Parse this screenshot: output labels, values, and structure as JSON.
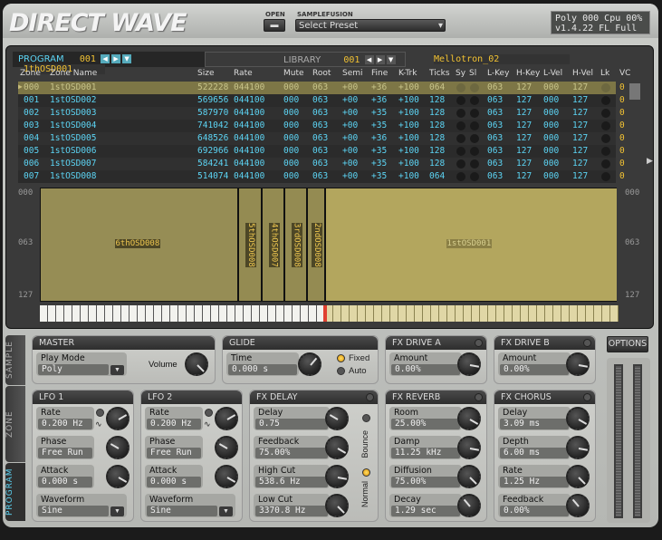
{
  "header": {
    "logo": "DIRECT WAVE",
    "open_label": "OPEN",
    "samplefusion_label": "SAMPLEFUSION",
    "preset_select": "Select Preset",
    "status_line1": "Poly 000 Cpu 00%",
    "status_line2": "v1.4.22  FL Full"
  },
  "program": {
    "tab": "PROGRAM",
    "number": "001",
    "name": "1thOSD001"
  },
  "library": {
    "tab": "LIBRARY",
    "number": "001",
    "name": "Mellotron_02"
  },
  "columns": [
    "Zone",
    "Zone Name",
    "Size",
    "Rate",
    "Mute",
    "Root",
    "Semi",
    "Fine",
    "K-Trk",
    "Ticks",
    "Sy",
    "Sl",
    "L-Key",
    "H-Key",
    "L-Vel",
    "H-Vel",
    "Lk",
    "VC"
  ],
  "rows": [
    [
      "000",
      "1stOSD001",
      "522228",
      "044100",
      "000",
      "063",
      "+00",
      "+36",
      "+100",
      "064",
      "",
      "",
      "063",
      "127",
      "000",
      "127",
      "",
      "0"
    ],
    [
      "001",
      "1stOSD002",
      "569656",
      "044100",
      "000",
      "063",
      "+00",
      "+36",
      "+100",
      "128",
      "",
      "",
      "063",
      "127",
      "000",
      "127",
      "",
      "0"
    ],
    [
      "002",
      "1stOSD003",
      "587970",
      "044100",
      "000",
      "063",
      "+00",
      "+35",
      "+100",
      "128",
      "",
      "",
      "063",
      "127",
      "000",
      "127",
      "",
      "0"
    ],
    [
      "003",
      "1stOSD004",
      "741042",
      "044100",
      "000",
      "063",
      "+00",
      "+35",
      "+100",
      "128",
      "",
      "",
      "063",
      "127",
      "000",
      "127",
      "",
      "0"
    ],
    [
      "004",
      "1stOSD005",
      "648526",
      "044100",
      "000",
      "063",
      "+00",
      "+36",
      "+100",
      "128",
      "",
      "",
      "063",
      "127",
      "000",
      "127",
      "",
      "0"
    ],
    [
      "005",
      "1stOSD006",
      "692966",
      "044100",
      "000",
      "063",
      "+00",
      "+35",
      "+100",
      "128",
      "",
      "",
      "063",
      "127",
      "000",
      "127",
      "",
      "0"
    ],
    [
      "006",
      "1stOSD007",
      "584241",
      "044100",
      "000",
      "063",
      "+00",
      "+35",
      "+100",
      "128",
      "",
      "",
      "063",
      "127",
      "000",
      "127",
      "",
      "0"
    ],
    [
      "007",
      "1stOSD008",
      "514074",
      "044100",
      "000",
      "063",
      "+00",
      "+35",
      "+100",
      "064",
      "",
      "",
      "063",
      "127",
      "000",
      "127",
      "",
      "0"
    ]
  ],
  "selected_row": 0,
  "zone_map": {
    "axis_left": [
      "000",
      "063",
      "127"
    ],
    "axis_right": [
      "000",
      "063",
      "127"
    ],
    "zones": [
      "6thOSD008",
      "5thOSD008",
      "4thOSD007",
      "3rdOSD008",
      "2ndOSD008",
      "1stOSD001"
    ]
  },
  "side_tabs": [
    "SAMPLE",
    "ZONE",
    "PROGRAM"
  ],
  "active_side_tab": "PROGRAM",
  "master": {
    "title": "MASTER",
    "play_mode_label": "Play Mode",
    "play_mode": "Poly",
    "volume_label": "Volume"
  },
  "glide": {
    "title": "GLIDE",
    "time_label": "Time",
    "time": "0.000 s",
    "fixed": "Fixed",
    "auto": "Auto",
    "selected": "Fixed"
  },
  "panels": {
    "drive_a": {
      "title": "FX DRIVE A",
      "params": [
        [
          "Amount",
          "0.00%"
        ]
      ]
    },
    "drive_b": {
      "title": "FX DRIVE B",
      "params": [
        [
          "Amount",
          "0.00%"
        ]
      ]
    },
    "lfo1": {
      "title": "LFO 1",
      "params": [
        [
          "Rate",
          "0.200 Hz"
        ],
        [
          "Phase",
          "Free Run"
        ],
        [
          "Attack",
          "0.000 s"
        ]
      ],
      "waveform_label": "Waveform",
      "waveform": "Sine"
    },
    "lfo2": {
      "title": "LFO 2",
      "params": [
        [
          "Rate",
          "0.200 Hz"
        ],
        [
          "Phase",
          "Free Run"
        ],
        [
          "Attack",
          "0.000 s"
        ]
      ],
      "waveform_label": "Waveform",
      "waveform": "Sine"
    },
    "delay": {
      "title": "FX DELAY",
      "params": [
        [
          "Delay",
          "0.75"
        ],
        [
          "Feedback",
          "75.00%"
        ],
        [
          "High Cut",
          "538.6 Hz"
        ],
        [
          "Low Cut",
          "3370.8 Hz"
        ]
      ],
      "bounce": "Bounce",
      "normal": "Normal",
      "mode": "Normal"
    },
    "reverb": {
      "title": "FX REVERB",
      "params": [
        [
          "Room",
          "25.00%"
        ],
        [
          "Damp",
          "11.25 kHz"
        ],
        [
          "Diffusion",
          "75.00%"
        ],
        [
          "Decay",
          "1.29 sec"
        ]
      ]
    },
    "chorus": {
      "title": "FX CHORUS",
      "params": [
        [
          "Delay",
          "3.09 ms"
        ],
        [
          "Depth",
          "6.00 ms"
        ],
        [
          "Rate",
          "1.25 Hz"
        ],
        [
          "Feedback",
          "0.00%"
        ]
      ]
    }
  },
  "options_label": "OPTIONS",
  "colors": {
    "cyan": "#5cd4f4",
    "yellow": "#f2c233",
    "zone": "#948b52",
    "selected_row": "#7d7646"
  }
}
